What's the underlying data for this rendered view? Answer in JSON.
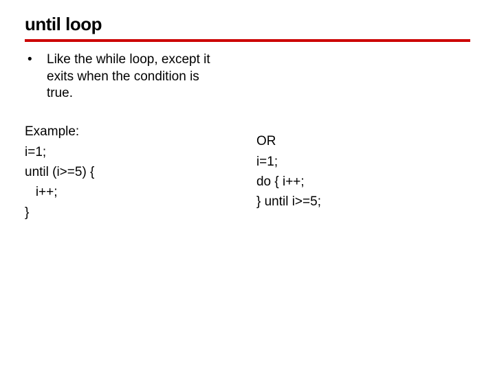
{
  "title": "until loop",
  "bullet": {
    "mark": "•",
    "text": "Like the while loop, except it exits when the condition is true."
  },
  "left_code": "Example:\ni=1;\nuntil (i>=5) {\n   i++;\n}",
  "right_code": "OR\ni=1;\ndo { i++;\n} until i>=5;"
}
